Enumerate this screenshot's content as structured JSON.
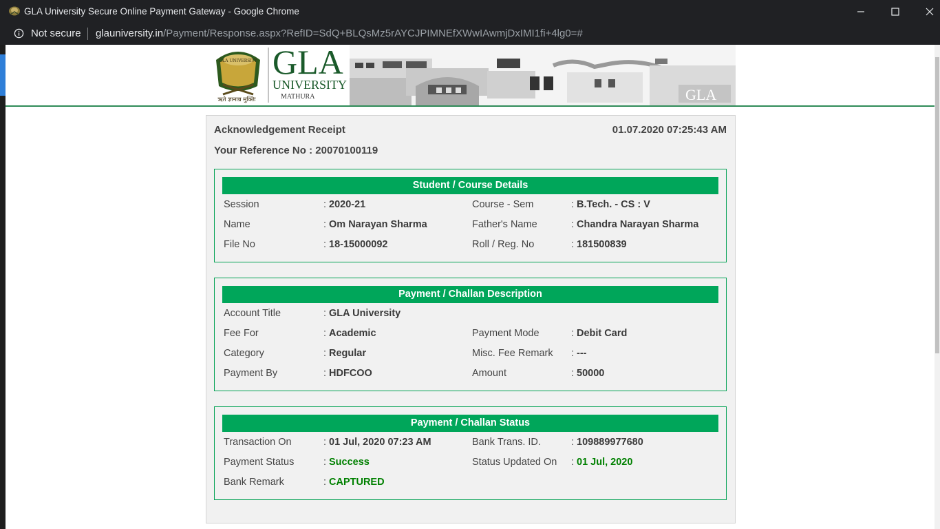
{
  "window": {
    "title": "GLA University Secure Online Payment Gateway - Google Chrome"
  },
  "address_bar": {
    "security_label": "Not secure",
    "url_host": "glauniversity.in",
    "url_path": "/Payment/Response.aspx?RefID=SdQ+BLQsMz5rAYCJPIMNEfXWwIAwmjDxIMI1fi+4lg0=#"
  },
  "banner": {
    "logo_text_big": "GLA",
    "logo_text_university": "UNIVERSITY",
    "logo_text_city": "MATHURA",
    "logo_seal_text": "GLA UNIVERSITY",
    "logo_motto": "ऋते ज्ञानान्न मुक्तिः",
    "watermark_text": "GLA"
  },
  "receipt": {
    "title": "Acknowledgement Receipt",
    "datetime": "01.07.2020 07:25:43 AM",
    "reference_label": "Your Reference No : ",
    "reference_no": "20070100119"
  },
  "colon": ":",
  "student_course": {
    "heading": "Student / Course Details",
    "session_label": "Session",
    "session_value": "2020-21",
    "course_sem_label": "Course - Sem",
    "course_sem_value": "B.Tech. - CS : V",
    "name_label": "Name",
    "name_value": "Om Narayan Sharma",
    "father_label": "Father's Name",
    "father_value": "Chandra Narayan Sharma",
    "file_label": "File No",
    "file_value": "18-15000092",
    "roll_label": "Roll / Reg. No",
    "roll_value": "181500839"
  },
  "payment_description": {
    "heading": "Payment / Challan Description",
    "account_label": "Account Title",
    "account_value": "GLA University",
    "fee_for_label": "Fee For",
    "fee_for_value": "Academic",
    "mode_label": "Payment Mode",
    "mode_value": "Debit Card",
    "category_label": "Category",
    "category_value": "Regular",
    "misc_label": "Misc. Fee Remark",
    "misc_value": "---",
    "paid_by_label": "Payment By",
    "paid_by_value": "HDFCOO",
    "amount_label": "Amount",
    "amount_value": "50000"
  },
  "payment_status": {
    "heading": "Payment / Challan Status",
    "txn_on_label": "Transaction On",
    "txn_on_value": "01 Jul, 2020 07:23 AM",
    "bank_txn_label": "Bank Trans. ID.",
    "bank_txn_value": "109889977680",
    "status_label": "Payment Status",
    "status_value": "Success",
    "updated_label": "Status Updated On",
    "updated_value": "01 Jul, 2020",
    "remark_label": "Bank Remark",
    "remark_value": "CAPTURED"
  },
  "colors": {
    "header_green": "#00a65a",
    "status_green": "#008000",
    "chrome_dark": "#202124"
  }
}
